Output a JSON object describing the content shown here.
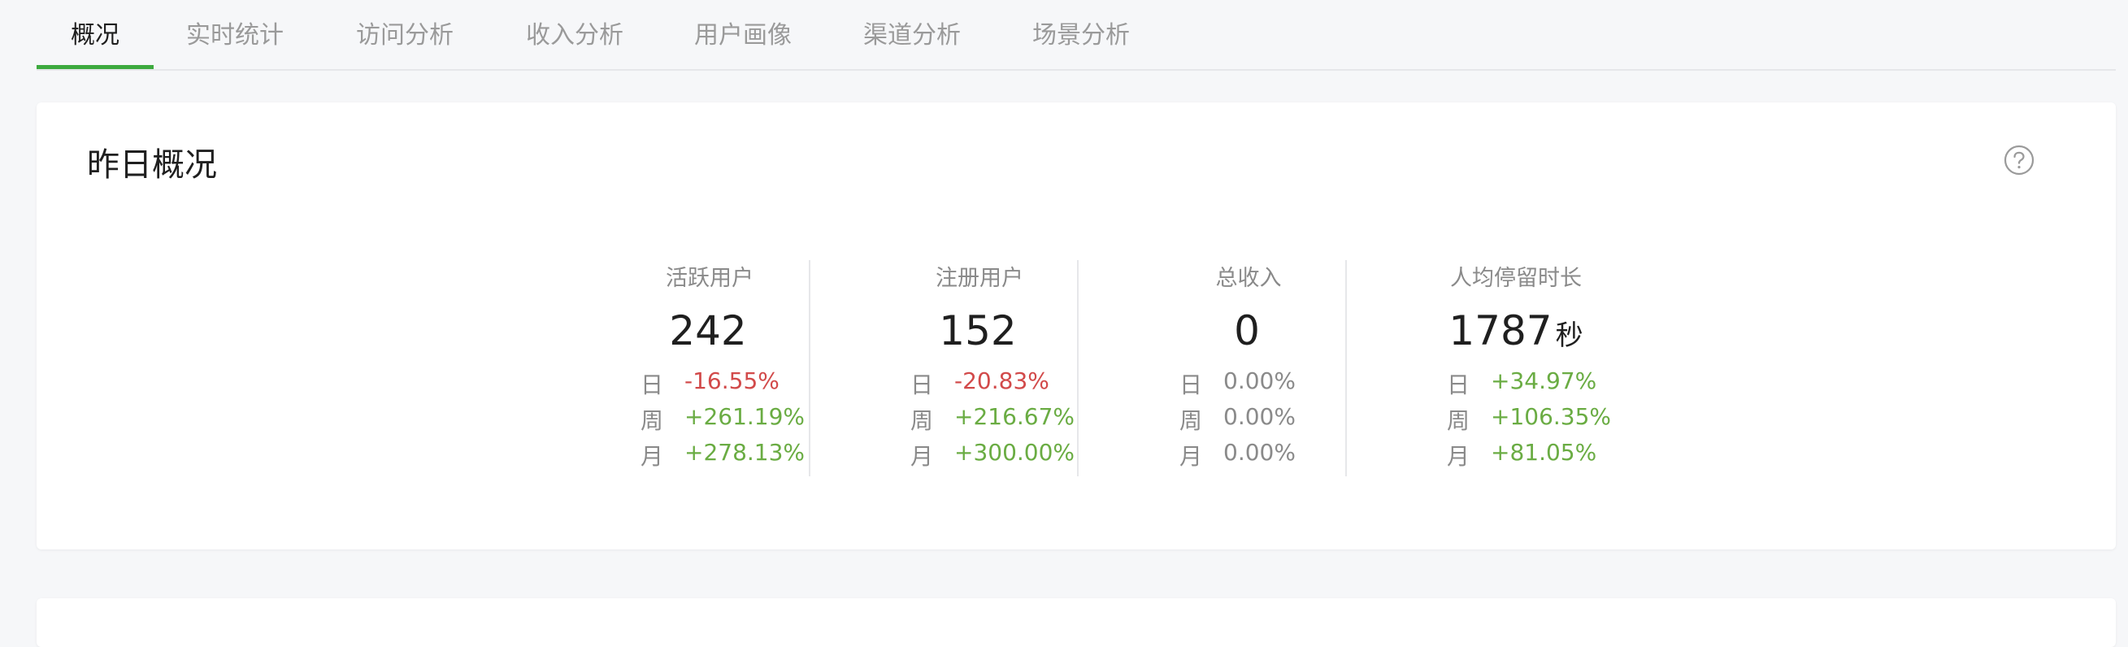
{
  "tabs": [
    {
      "label": "概况",
      "active": true
    },
    {
      "label": "实时统计",
      "active": false
    },
    {
      "label": "访问分析",
      "active": false
    },
    {
      "label": "收入分析",
      "active": false
    },
    {
      "label": "用户画像",
      "active": false
    },
    {
      "label": "渠道分析",
      "active": false
    },
    {
      "label": "场景分析",
      "active": false
    }
  ],
  "overview": {
    "title": "昨日概况",
    "help_icon": "question-circle-icon",
    "stats": [
      {
        "label": "活跃用户",
        "value": "242",
        "unit": "",
        "rows": [
          {
            "label": "日",
            "value": "-16.55%",
            "trend": "neg"
          },
          {
            "label": "周",
            "value": "+261.19%",
            "trend": "pos"
          },
          {
            "label": "月",
            "value": "+278.13%",
            "trend": "pos"
          }
        ]
      },
      {
        "label": "注册用户",
        "value": "152",
        "unit": "",
        "rows": [
          {
            "label": "日",
            "value": "-20.83%",
            "trend": "neg"
          },
          {
            "label": "周",
            "value": "+216.67%",
            "trend": "pos"
          },
          {
            "label": "月",
            "value": "+300.00%",
            "trend": "pos"
          }
        ]
      },
      {
        "label": "总收入",
        "value": "0",
        "unit": "",
        "rows": [
          {
            "label": "日",
            "value": "0.00%",
            "trend": "neu"
          },
          {
            "label": "周",
            "value": "0.00%",
            "trend": "neu"
          },
          {
            "label": "月",
            "value": "0.00%",
            "trend": "neu"
          }
        ]
      },
      {
        "label": "人均停留时长",
        "value": "1787",
        "unit": "秒",
        "rows": [
          {
            "label": "日",
            "value": "+34.97%",
            "trend": "pos"
          },
          {
            "label": "周",
            "value": "+106.35%",
            "trend": "pos"
          },
          {
            "label": "月",
            "value": "+81.05%",
            "trend": "pos"
          }
        ]
      }
    ]
  },
  "colors": {
    "accent_green": "#3daa3f",
    "positive": "#6aac43",
    "negative": "#d24a4a",
    "muted": "#8a8a8a"
  }
}
